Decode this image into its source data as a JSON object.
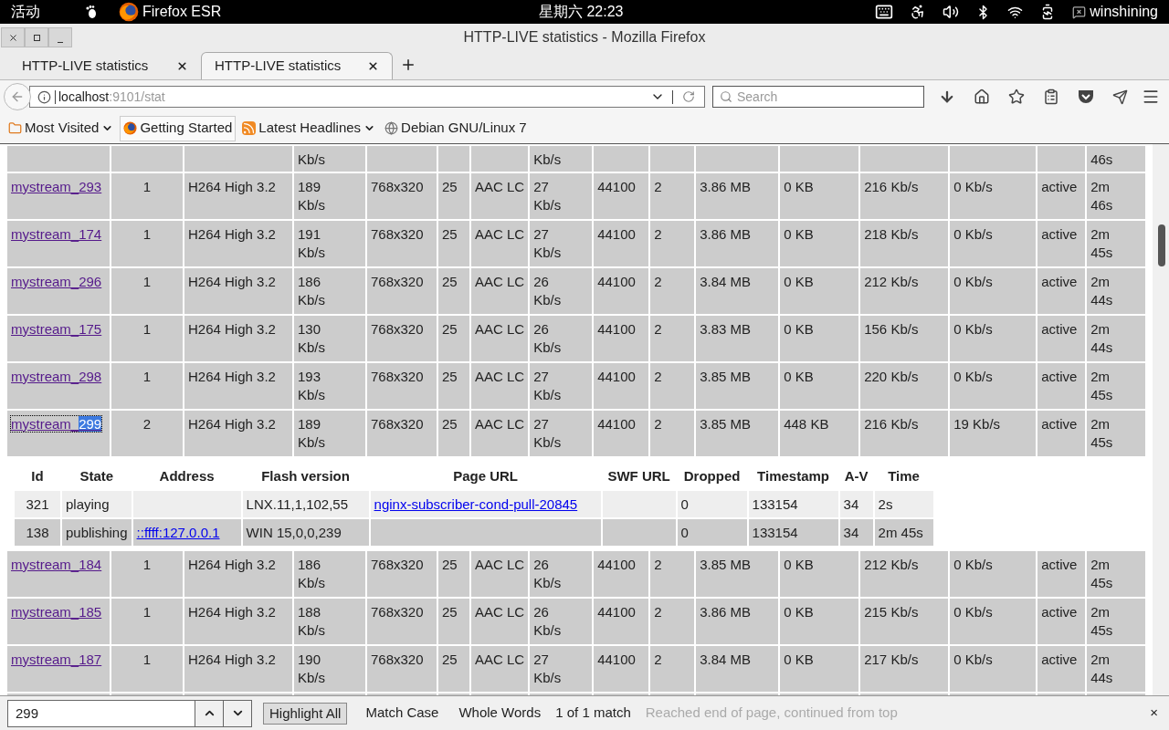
{
  "top_bar": {
    "activities": "活动",
    "app_name": "Firefox ESR",
    "clock": "星期六 22:23",
    "user": "winshining"
  },
  "window": {
    "title": "HTTP-LIVE statistics - Mozilla Firefox"
  },
  "tabs": [
    {
      "label": "HTTP-LIVE statistics",
      "selected": false
    },
    {
      "label": "HTTP-LIVE statistics",
      "selected": true
    }
  ],
  "address_bar": {
    "host": "localhost",
    "rest": ":9101/stat"
  },
  "search": {
    "placeholder": "Search"
  },
  "bookmarks": [
    {
      "label": "Most Visited",
      "kind": "folder"
    },
    {
      "label": "Getting Started",
      "kind": "page"
    },
    {
      "label": "Latest Headlines",
      "kind": "feed"
    },
    {
      "label": "Debian GNU/Linux 7",
      "kind": "site"
    }
  ],
  "partial_row": {
    "column_4": "Kb/s",
    "column_8": "Kb/s",
    "column_16": "46s"
  },
  "streams_before": [
    {
      "name": "mystream_293",
      "selected": false,
      "cells": [
        "1",
        "H264 High 3.2",
        "189 Kb/s",
        "768x320",
        "25",
        "AAC LC",
        "27 Kb/s",
        "44100",
        "2",
        "3.86 MB",
        "0 KB",
        "216 Kb/s",
        "0 Kb/s",
        "active",
        "2m 46s"
      ]
    },
    {
      "name": "mystream_174",
      "selected": false,
      "cells": [
        "1",
        "H264 High 3.2",
        "191 Kb/s",
        "768x320",
        "25",
        "AAC LC",
        "27 Kb/s",
        "44100",
        "2",
        "3.86 MB",
        "0 KB",
        "218 Kb/s",
        "0 Kb/s",
        "active",
        "2m 45s"
      ]
    },
    {
      "name": "mystream_296",
      "selected": false,
      "cells": [
        "1",
        "H264 High 3.2",
        "186 Kb/s",
        "768x320",
        "25",
        "AAC LC",
        "26 Kb/s",
        "44100",
        "2",
        "3.84 MB",
        "0 KB",
        "212 Kb/s",
        "0 Kb/s",
        "active",
        "2m 44s"
      ]
    },
    {
      "name": "mystream_175",
      "selected": false,
      "cells": [
        "1",
        "H264 High 3.2",
        "130 Kb/s",
        "768x320",
        "25",
        "AAC LC",
        "26 Kb/s",
        "44100",
        "2",
        "3.83 MB",
        "0 KB",
        "156 Kb/s",
        "0 Kb/s",
        "active",
        "2m 44s"
      ]
    },
    {
      "name": "mystream_298",
      "selected": false,
      "cells": [
        "1",
        "H264 High 3.2",
        "193 Kb/s",
        "768x320",
        "25",
        "AAC LC",
        "27 Kb/s",
        "44100",
        "2",
        "3.85 MB",
        "0 KB",
        "220 Kb/s",
        "0 Kb/s",
        "active",
        "2m 45s"
      ]
    },
    {
      "name": "mystream_",
      "highlighted": "299",
      "selected": true,
      "cells": [
        "2",
        "H264 High 3.2",
        "189 Kb/s",
        "768x320",
        "25",
        "AAC LC",
        "27 Kb/s",
        "44100",
        "2",
        "3.85 MB",
        "448 KB",
        "216 Kb/s",
        "19 Kb/s",
        "active",
        "2m 45s"
      ]
    }
  ],
  "clients": {
    "columns": [
      "Id",
      "State",
      "Address",
      "Flash version",
      "Page URL",
      "SWF URL",
      "Dropped",
      "Timestamp",
      "A-V",
      "Time"
    ],
    "rows": [
      {
        "id": "321",
        "state": "playing",
        "flash_version": "LNX.11,1,102,55",
        "page_url": "nginx-subscriber-cond-pull-20845",
        "dropped": "0",
        "timestamp": "133154",
        "av": "34",
        "time": "2s"
      },
      {
        "id": "138",
        "state": "publishing",
        "address": "::ffff:127.0.0.1",
        "flash_version": "WIN 15,0,0,239",
        "dropped": "0",
        "timestamp": "133154",
        "av": "34",
        "time": "2m 45s"
      }
    ]
  },
  "streams_after": [
    {
      "name": "mystream_184",
      "selected": false,
      "cells": [
        "1",
        "H264 High 3.2",
        "186 Kb/s",
        "768x320",
        "25",
        "AAC LC",
        "26 Kb/s",
        "44100",
        "2",
        "3.85 MB",
        "0 KB",
        "212 Kb/s",
        "0 Kb/s",
        "active",
        "2m 45s"
      ]
    },
    {
      "name": "mystream_185",
      "selected": false,
      "cells": [
        "1",
        "H264 High 3.2",
        "188 Kb/s",
        "768x320",
        "25",
        "AAC LC",
        "26 Kb/s",
        "44100",
        "2",
        "3.86 MB",
        "0 KB",
        "215 Kb/s",
        "0 Kb/s",
        "active",
        "2m 45s"
      ]
    },
    {
      "name": "mystream_187",
      "selected": false,
      "cells": [
        "1",
        "H264 High 3.2",
        "190 Kb/s",
        "768x320",
        "25",
        "AAC LC",
        "27 Kb/s",
        "44100",
        "2",
        "3.84 MB",
        "0 KB",
        "217 Kb/s",
        "0 Kb/s",
        "active",
        "2m 44s"
      ]
    }
  ],
  "find_bar": {
    "value": "299",
    "highlight_all": "Highlight All",
    "match_case": "Match Case",
    "whole_words": "Whole Words",
    "result": "1 of 1 match",
    "status": "Reached end of page, continued from top",
    "close": "×"
  }
}
